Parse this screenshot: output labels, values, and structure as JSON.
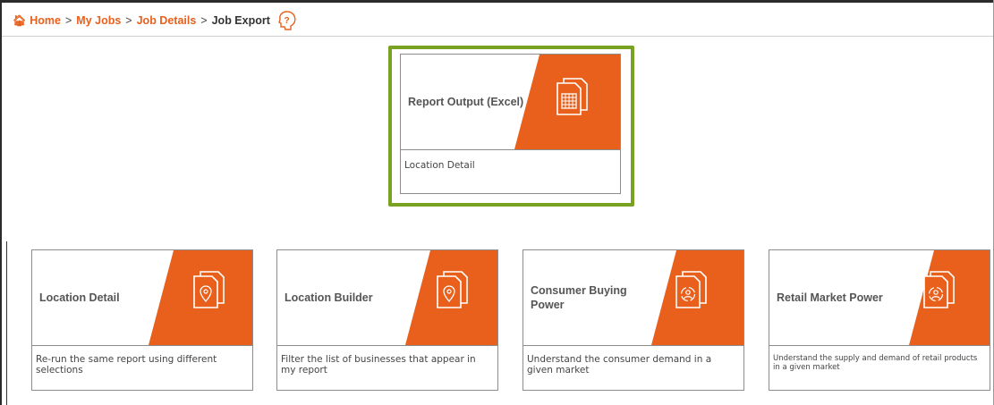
{
  "breadcrumb": {
    "home": "Home",
    "my_jobs": "My Jobs",
    "job_details": "Job Details",
    "current": "Job Export"
  },
  "featured_card": {
    "title": "Report Output (Excel)",
    "description": "Location Detail",
    "icon": "spreadsheet-document-icon"
  },
  "cards": [
    {
      "title": "Location Detail",
      "description": "Re-run the same report using different selections",
      "icon": "location-document-icon"
    },
    {
      "title": "Location Builder",
      "description": "Filter the list of businesses that appear in my report",
      "icon": "location-document-icon"
    },
    {
      "title": "Consumer Buying Power",
      "description": "Understand the consumer demand in a given market",
      "icon": "consumer-document-icon"
    },
    {
      "title": "Retail Market Power",
      "description": "Understand the supply and demand of retail products in a given market",
      "icon": "retail-document-icon"
    }
  ],
  "colors": {
    "accent": "#e8601c",
    "highlight": "#7aa222"
  }
}
